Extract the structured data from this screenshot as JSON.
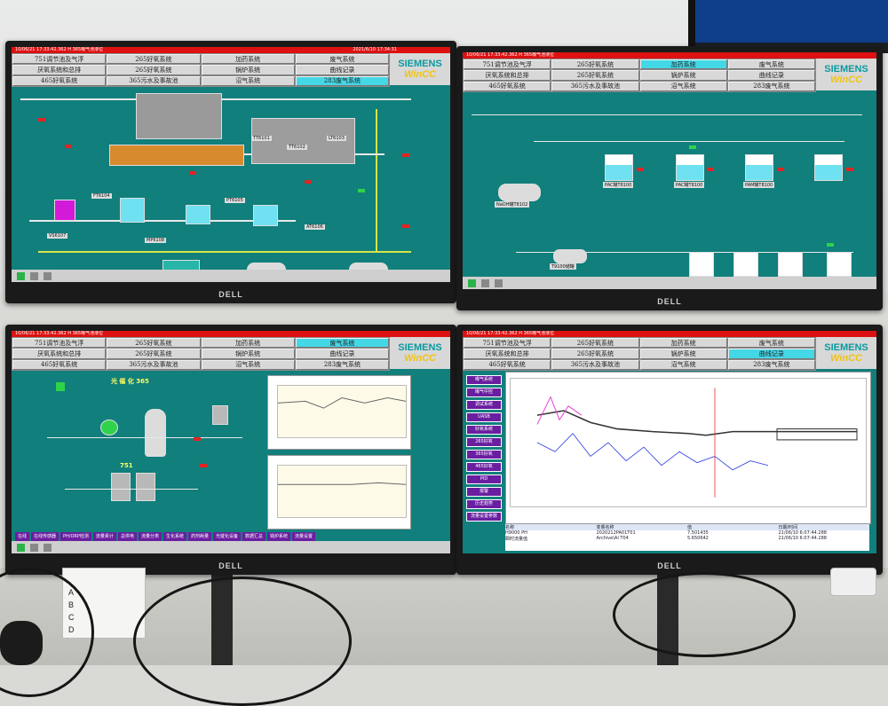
{
  "scene": {
    "brand": "DELL"
  },
  "hmi": {
    "status_text_1": "10/06/21 17:33:42.362  H  365曝气池液位",
    "status_text_2": "10/06/21 17:33:42.362  H  365曝气池液位",
    "status_text_3": "10/06/21 17:33:42.362  H  365曝气池液位",
    "datetime": "2021/6/10 17:34:31",
    "logo_siemens": "SIEMENS",
    "logo_wincc": "WinCC",
    "nav": [
      "751调节池及气浮",
      "265好氧系统",
      "加药系统",
      "废气系统",
      "厌氧系统和总排",
      "265好氧系统",
      "锅炉系统",
      "曲线记录",
      "465好氧系统",
      "365污水及事故池",
      "沼气系统",
      "283废气系统"
    ],
    "nav_active_1": "283废气系统",
    "nav_active_2": "加药系统",
    "nav_active_3": "废气系统",
    "nav_active_4": "曲线记录",
    "screen3_title": "光 催 化  365",
    "screen3_label_751": "751",
    "screen2_tank_labels": [
      "PAC罐T8100",
      "NaOH罐T8102",
      "PAC罐T8100",
      "PAM罐T8100",
      "T9100储罐"
    ],
    "screen1_tags": [
      "TT6101",
      "TT6102",
      "LT6103",
      "FT6104",
      "PT6105",
      "AT6106",
      "VS6107",
      "MP6108"
    ],
    "screen3_bottom": [
      "在线",
      "在线传感器",
      "PH/ORP检测",
      "流量累计",
      "总供电",
      "流量分类",
      "生化系统",
      "药剂耗量",
      "光催化设备",
      "数据汇总",
      "锅炉系统",
      "流量设置"
    ],
    "screen4_side": [
      "曝气系统",
      "曝气中控",
      "调试系统",
      "UASB",
      "好氧系统",
      "265好氧",
      "365好氧",
      "465好氧",
      "PID",
      "报警",
      "历史趋势",
      "流量设置参数"
    ],
    "screen4_table_header": [
      "名称",
      "变量名称",
      "值",
      "日期/时间"
    ],
    "screen4_table_rows": [
      [
        "H9000 PH",
        "2020212PA01T01",
        "7.501435",
        "21/06/10 6:07:44.288"
      ],
      [
        "瞬时流量值",
        "Archive\\AI T04",
        "5.650642",
        "21/06/10 6:07:44.288"
      ]
    ]
  },
  "paper": {
    "letters": [
      "A",
      "B",
      "C",
      "D"
    ]
  }
}
